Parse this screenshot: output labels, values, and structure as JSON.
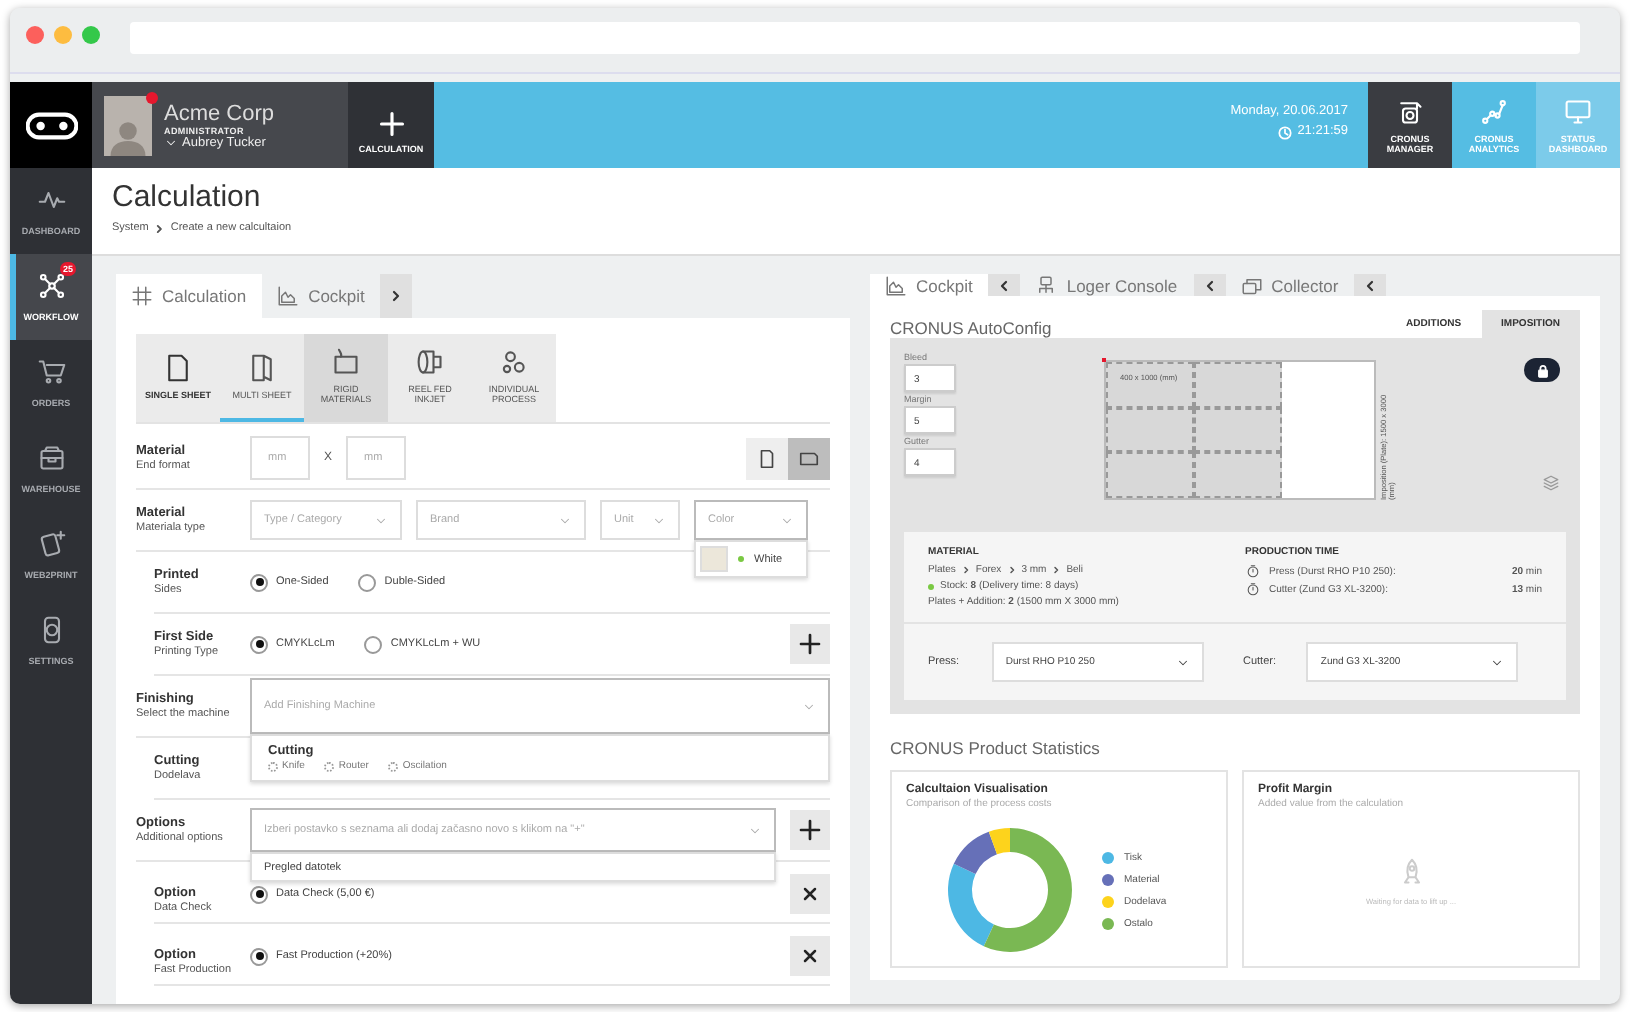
{
  "header": {
    "company": "Acme Corp",
    "role": "ADMINISTRATOR",
    "user": "Aubrey Tucker",
    "has_notification": true,
    "new_button": "CALCULATION",
    "date": "Monday, 20.06.2017",
    "time": "21:21:59",
    "apps": [
      {
        "kind": "manager",
        "label": "CRONUS MANAGER",
        "selected": true
      },
      {
        "kind": "analytics",
        "label": "CRONUS ANALYTICS",
        "selected": false
      },
      {
        "kind": "dashboard",
        "label": "STATUS DASHBOARD",
        "selected": false
      }
    ]
  },
  "sidebar": {
    "items": [
      {
        "kind": "dashboard",
        "label": "DASHBOARD",
        "selected": false
      },
      {
        "kind": "workflow",
        "label": "WORKFLOW",
        "selected": true,
        "badge": "25"
      },
      {
        "kind": "orders",
        "label": "ORDERS",
        "selected": false
      },
      {
        "kind": "warehouse",
        "label": "WAREHOUSE",
        "selected": false
      },
      {
        "kind": "web2print",
        "label": "WEB2PRINT",
        "selected": false
      },
      {
        "kind": "settings",
        "label": "SETTINGS",
        "selected": false
      }
    ]
  },
  "page": {
    "title": "Calculation",
    "breadcrumb": [
      "System",
      "Create a new calcultaion"
    ]
  },
  "left_panel": {
    "tabs": [
      {
        "kind": "grid",
        "label": "Calculation",
        "selected": true
      },
      {
        "kind": "chart",
        "label": "Cockpit",
        "selected": false
      }
    ],
    "process_types": [
      {
        "kind": "single",
        "label": "SINGLE SHEET",
        "selected": false,
        "highlighted": false
      },
      {
        "kind": "multi",
        "label": "MULTI SHEET",
        "selected": true,
        "highlighted": false
      },
      {
        "kind": "rigid",
        "label": "RIGID MATERIALS",
        "selected": false,
        "highlighted": true
      },
      {
        "kind": "reel",
        "label": "REEL FED INKJET",
        "selected": false,
        "highlighted": false
      },
      {
        "kind": "process",
        "label": "INDIVIDUAL PROCESS",
        "selected": false,
        "highlighted": false
      }
    ],
    "rows": [
      {
        "kind": "format",
        "title": "Material",
        "subtitle": "End format",
        "width_placeholder": "mm",
        "separator": "X",
        "height_placeholder": "mm",
        "orientations": [
          {
            "kind": "portrait",
            "selected": false
          },
          {
            "kind": "landscape",
            "selected": true
          }
        ]
      },
      {
        "kind": "selects",
        "title": "Material",
        "subtitle": "Materiala type",
        "selects": [
          {
            "placeholder": "Type / Category"
          },
          {
            "placeholder": "Brand"
          },
          {
            "placeholder": "Unit"
          },
          {
            "placeholder": "Color",
            "open": true,
            "options": [
              {
                "label": "White",
                "in_stock": true
              }
            ]
          }
        ],
        "children": [
          {
            "kind": "radios",
            "title": "Printed",
            "subtitle": "Sides",
            "options": [
              {
                "label": "One-Sided",
                "selected": true
              },
              {
                "label": "Duble-Sided",
                "selected": false
              }
            ]
          },
          {
            "kind": "radios",
            "title": "First Side",
            "subtitle": "Printing Type",
            "add_button": true,
            "options": [
              {
                "label": "CMYKLcLm",
                "selected": true
              },
              {
                "label": "CMYKLcLm + WU",
                "selected": false
              }
            ]
          }
        ]
      },
      {
        "kind": "select",
        "title": "Finishing",
        "subtitle": "Select the machine",
        "placeholder": "Add Finishing Machine",
        "open": true,
        "menu": {
          "group": "Cutting",
          "options": [
            {
              "label": "Knife",
              "selected": false
            },
            {
              "label": "Router",
              "selected": false
            },
            {
              "label": "Oscilation",
              "selected": false
            }
          ]
        },
        "children": [
          {
            "kind": "plain",
            "title": "Cutting",
            "subtitle": "Dodelava"
          }
        ]
      },
      {
        "kind": "select",
        "title": "Options",
        "subtitle": "Additional options",
        "placeholder": "Izberi postavko s seznama ali dodaj začasno novo s klikom na \"+\"",
        "add_button": true,
        "open": true,
        "menu": {
          "options": [
            {
              "label": "Pregled datotek",
              "selected": false
            }
          ]
        },
        "children": [
          {
            "kind": "radios",
            "title": "Option",
            "subtitle": "Data Check",
            "remove_button": true,
            "options": [
              {
                "label": "Data Check (5,00 €)",
                "selected": true
              }
            ]
          },
          {
            "kind": "radios",
            "title": "Option",
            "subtitle": "Fast Production",
            "remove_button": true,
            "options": [
              {
                "label": "Fast Production (+20%)",
                "selected": true
              }
            ]
          }
        ]
      }
    ]
  },
  "right_panel": {
    "tabs": [
      {
        "kind": "chart",
        "label": "Cockpit",
        "selected": true
      },
      {
        "kind": "console",
        "label": "Loger Console",
        "selected": false
      },
      {
        "kind": "collector",
        "label": "Collector",
        "selected": false
      }
    ],
    "autoconfig": {
      "title": "CRONUS AutoConfig",
      "tabs": [
        {
          "label": "ADDITIONS",
          "selected": false
        },
        {
          "label": "IMPOSITION",
          "selected": true
        }
      ],
      "fields": [
        {
          "label": "Bleed",
          "value": "3"
        },
        {
          "label": "Margin",
          "value": "5"
        },
        {
          "label": "Gutter",
          "value": "4"
        }
      ],
      "piece": "400 x 1000 (mm)",
      "plate": "Imposition (Plate): 1500 x 3000 (mm)",
      "locked": true,
      "material": {
        "title": "MATERIAL",
        "path": [
          "Plates",
          "Forex",
          "3 mm",
          "Beli"
        ],
        "stock": "Stock: **8** (Delivery time: 8 days)",
        "in_stock": true,
        "plates": "Plates + Addition:  **2** (1500 mm X 3000 mm)"
      },
      "production": {
        "title": "PRODUCTION TIME",
        "items": [
          {
            "label": "Press (Durst RHO P10 250):",
            "value": "**20** min"
          },
          {
            "label": "Cutter (Zund G3 XL-3200):",
            "value": "**13** min"
          }
        ]
      },
      "machines": [
        {
          "label": "Press:",
          "value": "Durst RHO P10 250"
        },
        {
          "label": "Cutter:",
          "value": "Zund G3 XL-3200"
        }
      ]
    },
    "statistics": {
      "title": "CRONUS Product Statistics",
      "cards": [
        {
          "kind": "donut",
          "title": "Calcultaion Visualisation",
          "subtitle": "Comparison of the process costs",
          "legend": [
            {
              "label": "Tisk",
              "color": "#4db8e4"
            },
            {
              "label": "Material",
              "color": "#6670b8"
            },
            {
              "label": "Dodelava",
              "color": "#fdd31c"
            },
            {
              "label": "Ostalo",
              "color": "#7ab853"
            }
          ]
        },
        {
          "kind": "empty",
          "title": "Profit Margin",
          "subtitle": "Added value from the calculation",
          "message": "Waiting for data to lift up ..."
        }
      ]
    }
  }
}
